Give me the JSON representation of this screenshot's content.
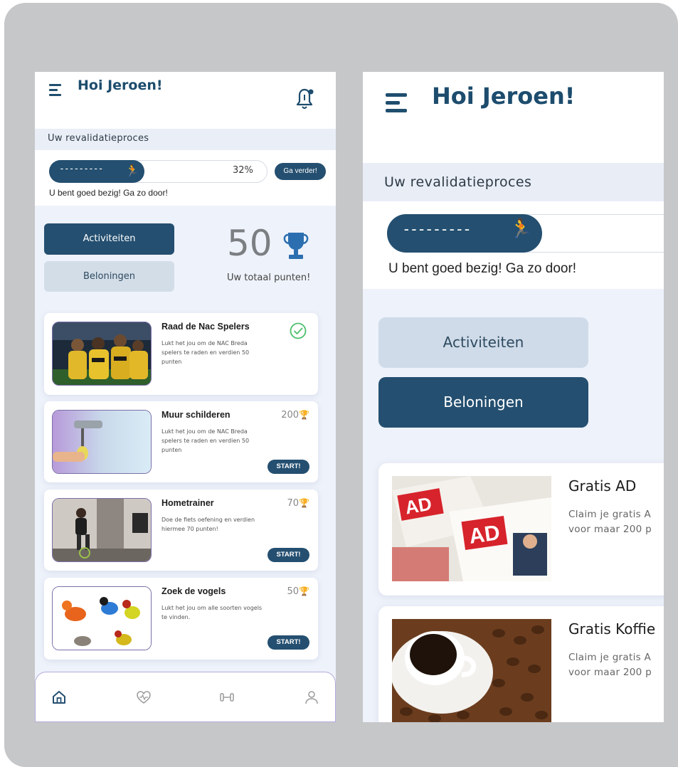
{
  "left": {
    "header": {
      "title": "Hoi Jeroen!"
    },
    "section_title": "Uw revalidatieproces",
    "progress": {
      "percent_label": "32%",
      "value": 0.32,
      "button": "Ga verder!",
      "message": "U bent goed bezig! Ga zo door!"
    },
    "tabs": {
      "activities": "Activiteiten",
      "rewards": "Beloningen"
    },
    "points": {
      "value": "50",
      "label": "Uw totaal punten!"
    },
    "activities": [
      {
        "title": "Raad de Nac Spelers",
        "desc": "Lukt het jou om de NAC Breda spelers te raden en verdien 50 punten",
        "status": "completed"
      },
      {
        "title": "Muur schilderen",
        "desc": "Lukt het jou om de NAC Breda spelers te raden en verdien 50 punten",
        "points": "200",
        "button": "START!"
      },
      {
        "title": "Hometrainer",
        "desc": "Doe de fiets oefening en verdien hiermee 70 punten!",
        "points": "70",
        "button": "START!"
      },
      {
        "title": "Zoek de vogels",
        "desc": "Lukt het jou om alle soorten vogels te vinden.",
        "points": "50",
        "button": "START!"
      }
    ],
    "nav": [
      "home-icon",
      "heart-pulse-icon",
      "dumbbell-icon",
      "profile-icon"
    ]
  },
  "right": {
    "header": {
      "title": "Hoi Jeroen!"
    },
    "section_title": "Uw revalidatieproces",
    "progress": {
      "message": "U bent goed bezig! Ga zo door!"
    },
    "tabs": {
      "activities": "Activiteiten",
      "rewards": "Beloningen"
    },
    "rewards": [
      {
        "title": "Gratis AD",
        "desc_line1": "Claim je gratis A",
        "desc_line2": "voor maar 200 p"
      },
      {
        "title": "Gratis Koffie",
        "desc_line1": "Claim je gratis A",
        "desc_line2": "voor maar 200 p"
      }
    ]
  },
  "colors": {
    "primary": "#244f70",
    "title": "#1d4c6d",
    "tab_inactive": "#d3dde8",
    "background": "#eef2fa",
    "frame": "#c6c7c9",
    "trophy": "#2c6fb0",
    "check": "#4cbf6b"
  }
}
